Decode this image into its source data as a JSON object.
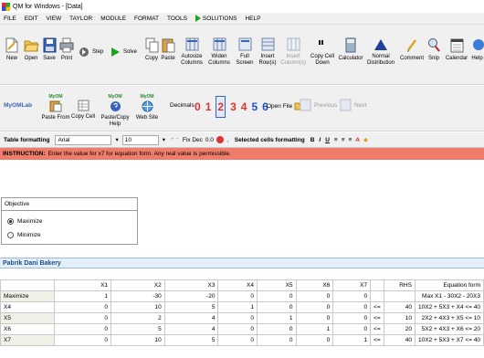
{
  "window": {
    "title": "QM for Windows - [Data]"
  },
  "menu": {
    "items": [
      "FILE",
      "EDIT",
      "VIEW",
      "TAYLOR",
      "MODULE",
      "FORMAT",
      "TOOLS",
      "SOLUTIONS",
      "HELP"
    ]
  },
  "toolbar": {
    "new": "New",
    "open": "Open",
    "save": "Save",
    "print": "Print",
    "step": "Step",
    "solve": "Solve",
    "copy": "Copy",
    "paste": "Paste",
    "autosize_1": "Autosize",
    "autosize_2": "Columns",
    "widen_1": "Widen",
    "widen_2": "Columns",
    "full_1": "Full",
    "full_2": "Screen",
    "insert_rows_1": "Insert",
    "insert_rows_2": "Row(s)",
    "insert_cols_1": "Insert",
    "insert_cols_2": "Column(s)",
    "copycell_1": "Copy Cell",
    "copycell_2": "Down",
    "calculator": "Calculator",
    "normal_1": "Normal",
    "normal_2": "Distribution",
    "comment": "Comment",
    "snip": "Snip",
    "calendar": "Calendar",
    "help": "Help"
  },
  "toolbar2": {
    "myomlab": "MyOMLab",
    "paste_from": "Paste From",
    "copy_cell": "Copy Cell",
    "paste_copy_help": "Paste/Copy Help",
    "web_site": "Web Site",
    "myom_badge": "MyOM",
    "decimals": "Decimals",
    "digits": [
      "0",
      "1",
      "2",
      "3",
      "4",
      "5",
      "6"
    ],
    "open_file": "Open File",
    "previous": "Previous",
    "next": "Next"
  },
  "formatting": {
    "label": "Table formatting",
    "font": "Arial",
    "size": "10",
    "fix_dec_label": "Fix Dec",
    "fix_dec_value": "0.0",
    "selected_label": "Selected cells formatting",
    "bold": "B",
    "italic": "I",
    "underline": "U"
  },
  "instruction": {
    "label": "INSTRUCTION:",
    "text": "Enter the value for x7 for equation form. Any real value is permissible."
  },
  "objective": {
    "label": "Objective",
    "options": [
      "Maximize",
      "Minimize"
    ],
    "selected": "Maximize"
  },
  "problem": {
    "title": "Pabrik Dani Bakery"
  },
  "table": {
    "headers": [
      "",
      "X1",
      "X2",
      "X3",
      "X4",
      "X5",
      "X6",
      "X7",
      "",
      "RHS",
      "Equation form"
    ],
    "rows": [
      [
        "Maximize",
        "1",
        "-30",
        "-20",
        "0",
        "0",
        "0",
        "0",
        "",
        "",
        "Max X1 - 30X2 - 20X3"
      ],
      [
        "X4",
        "0",
        "10",
        "5",
        "1",
        "0",
        "0",
        "0",
        "<=",
        "40",
        "10X2 + 5X3 + X4 <= 40"
      ],
      [
        "X5",
        "0",
        "2",
        "4",
        "0",
        "1",
        "0",
        "0",
        "<=",
        "10",
        "2X2 + 4X3 + X5 <= 10"
      ],
      [
        "X6",
        "0",
        "5",
        "4",
        "0",
        "0",
        "1",
        "0",
        "<=",
        "20",
        "5X2 + 4X3 + X6 <= 20"
      ],
      [
        "X7",
        "0",
        "10",
        "5",
        "0",
        "0",
        "0",
        "1",
        "<=",
        "40",
        "10X2 + 5X3 + X7 <= 40"
      ]
    ]
  },
  "colors": {
    "instruction_bg": "#f07c6c",
    "problem_title": "#1a4f8a",
    "digit_red": "#e03030",
    "digit_blue": "#2050c0"
  }
}
